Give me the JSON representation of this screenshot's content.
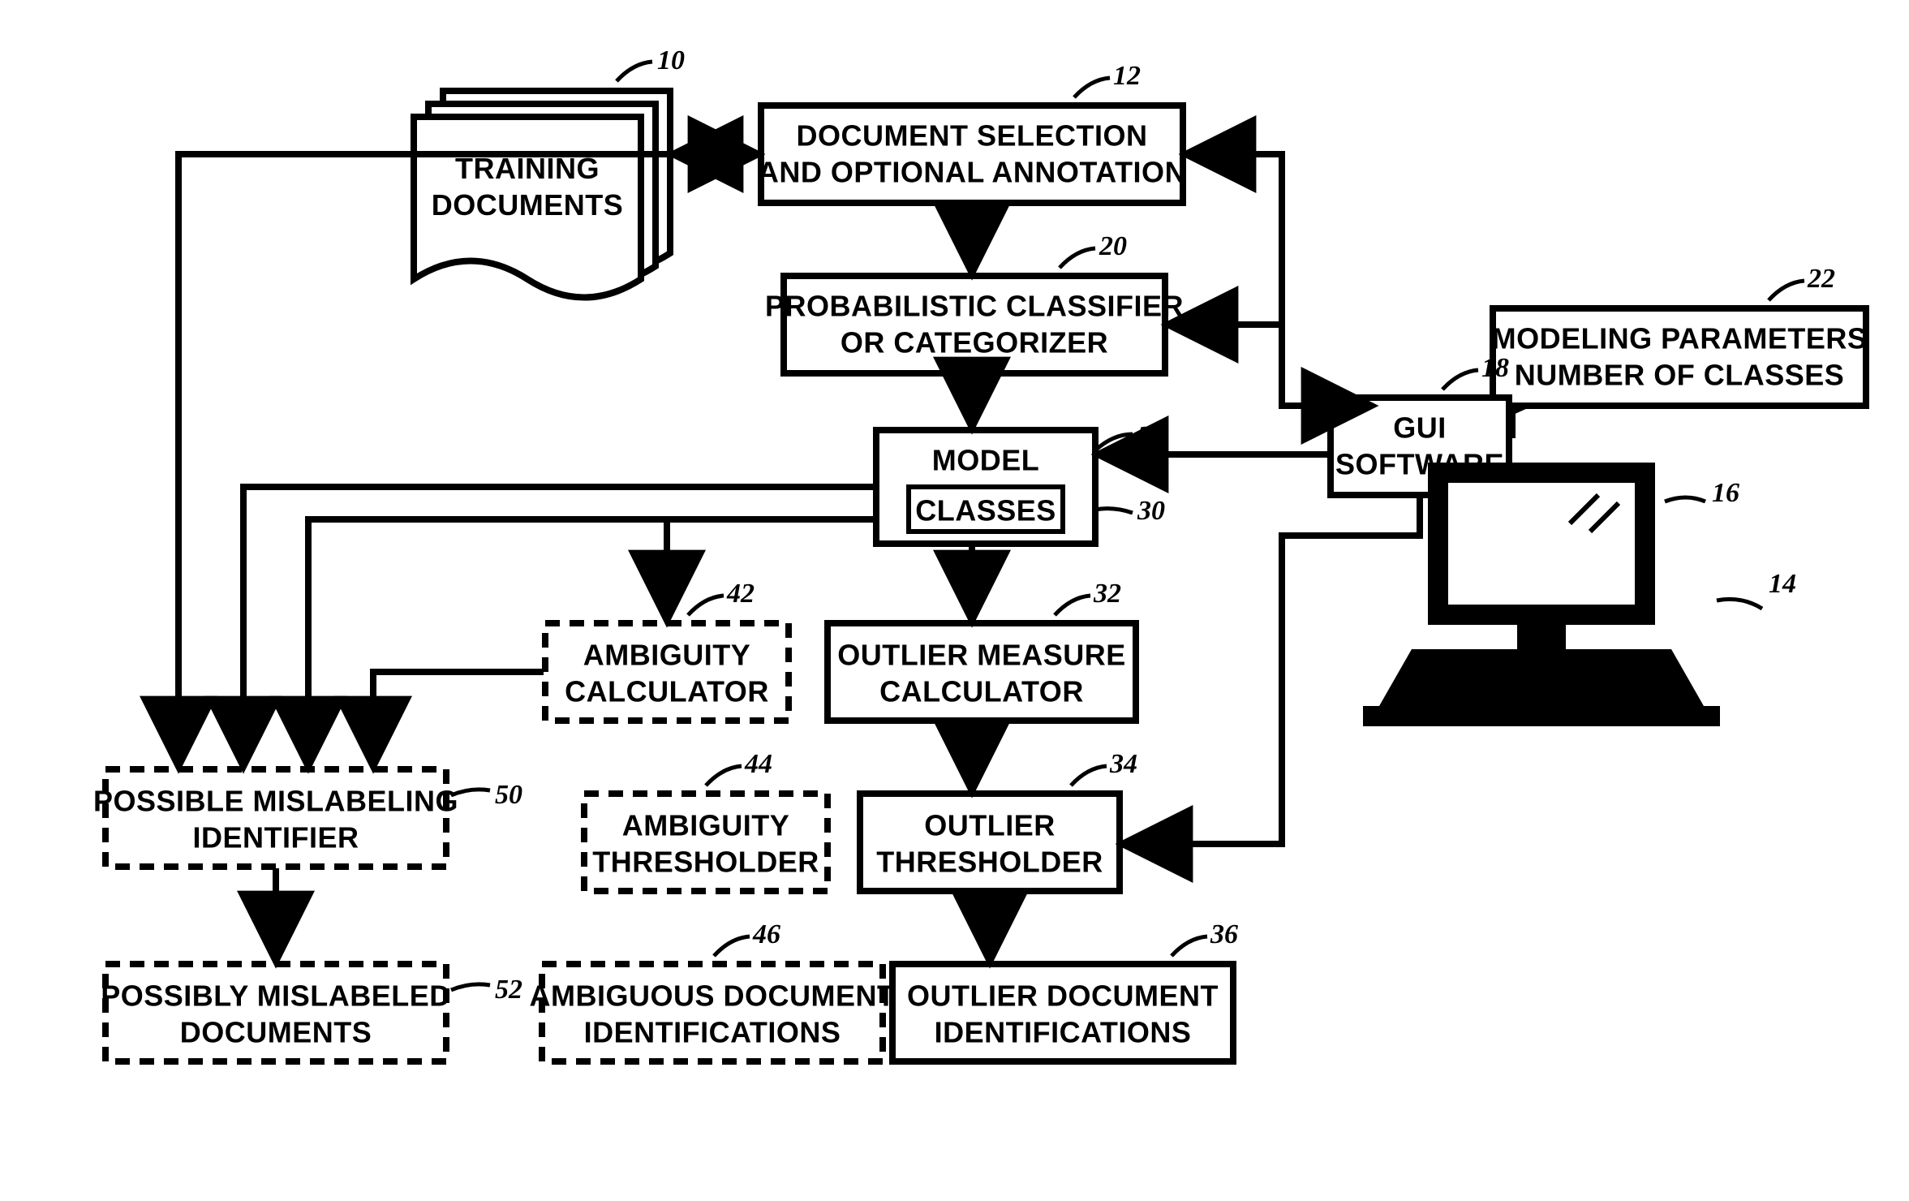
{
  "diagram": {
    "nodes": {
      "training_documents": {
        "label": "TRAINING\nDOCUMENTS",
        "ref": "10"
      },
      "doc_selection": {
        "label": "DOCUMENT SELECTION\nAND OPTIONAL ANNOTATION",
        "ref": "12"
      },
      "classifier": {
        "label": "PROBABILISTIC CLASSIFIER\nOR CATEGORIZER",
        "ref": "20"
      },
      "modeling_params": {
        "label": "MODELING PARAMETERS\nNUMBER OF CLASSES",
        "ref": "22"
      },
      "gui_software": {
        "label": "GUI\nSOFTWARE",
        "ref": "18"
      },
      "computer": {
        "ref": "14"
      },
      "monitor": {
        "ref": "16"
      },
      "model": {
        "label": "MODEL",
        "ref": "24"
      },
      "classes": {
        "label": "CLASSES",
        "ref": "30"
      },
      "ambiguity_calc": {
        "label": "AMBIGUITY\nCALCULATOR",
        "ref": "42"
      },
      "outlier_calc": {
        "label": "OUTLIER MEASURE\nCALCULATOR",
        "ref": "32"
      },
      "possible_mislabel": {
        "label": "POSSIBLE MISLABELING\nIDENTIFIER",
        "ref": "50"
      },
      "ambiguity_thresh": {
        "label": "AMBIGUITY\nTHRESHOLDER",
        "ref": "44"
      },
      "outlier_thresh": {
        "label": "OUTLIER\nTHRESHOLDER",
        "ref": "34"
      },
      "possibly_mislabeled": {
        "label": "POSSIBLY MISLABELED\nDOCUMENTS",
        "ref": "52"
      },
      "ambiguous_ids": {
        "label": "AMBIGUOUS DOCUMENT\nIDENTIFICATIONS",
        "ref": "46"
      },
      "outlier_ids": {
        "label": "OUTLIER DOCUMENT\nIDENTIFICATIONS",
        "ref": "36"
      }
    }
  }
}
